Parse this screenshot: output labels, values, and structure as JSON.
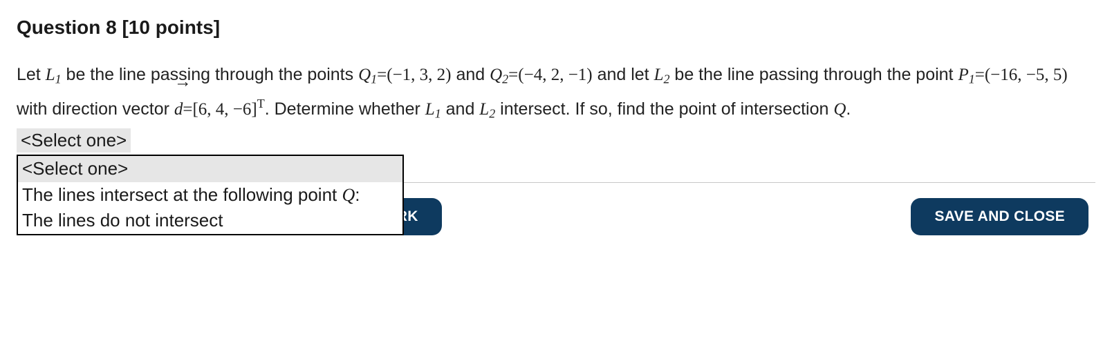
{
  "heading": "Question 8 [10 points]",
  "statement": {
    "t1": "Let ",
    "L1": "L",
    "sub1": "1",
    "t2": " be the line passing through the points ",
    "Q1label": "Q",
    "Q1sub": "1",
    "Q1val": "=(−1, 3, 2)",
    "t3": " and ",
    "Q2label": "Q",
    "Q2sub": "2",
    "Q2val": "=(−4, 2, −1)",
    "t4": " and let ",
    "L2": "L",
    "sub2": "2",
    "t5": " be the line passing through the point ",
    "P1label": "P",
    "P1sub": "1",
    "P1val": "=(−16, −5, 5)",
    "t6": " with direction vector ",
    "dlabel": "d",
    "darrow": "→",
    "dval": "=[6, 4, −6]",
    "dT": "T",
    "t7": ". Determine whether ",
    "L1b": "L",
    "sub1b": "1",
    "t8": " and ",
    "L2b": "L",
    "sub2b": "2",
    "t9": " intersect. If so, find the point of intersection ",
    "Qlabel": "Q",
    "t10": "."
  },
  "dropdown": {
    "selected": "<Select one>",
    "options": {
      "placeholder": "<Select one>",
      "opt1_prefix": "The lines intersect at the following point ",
      "opt1_Q": "Q",
      "opt1_suffix": ":",
      "opt2": "The lines do not intersect"
    }
  },
  "buttons": {
    "mark_visible_fragment": "AND MARK",
    "close": "SAVE AND CLOSE"
  }
}
